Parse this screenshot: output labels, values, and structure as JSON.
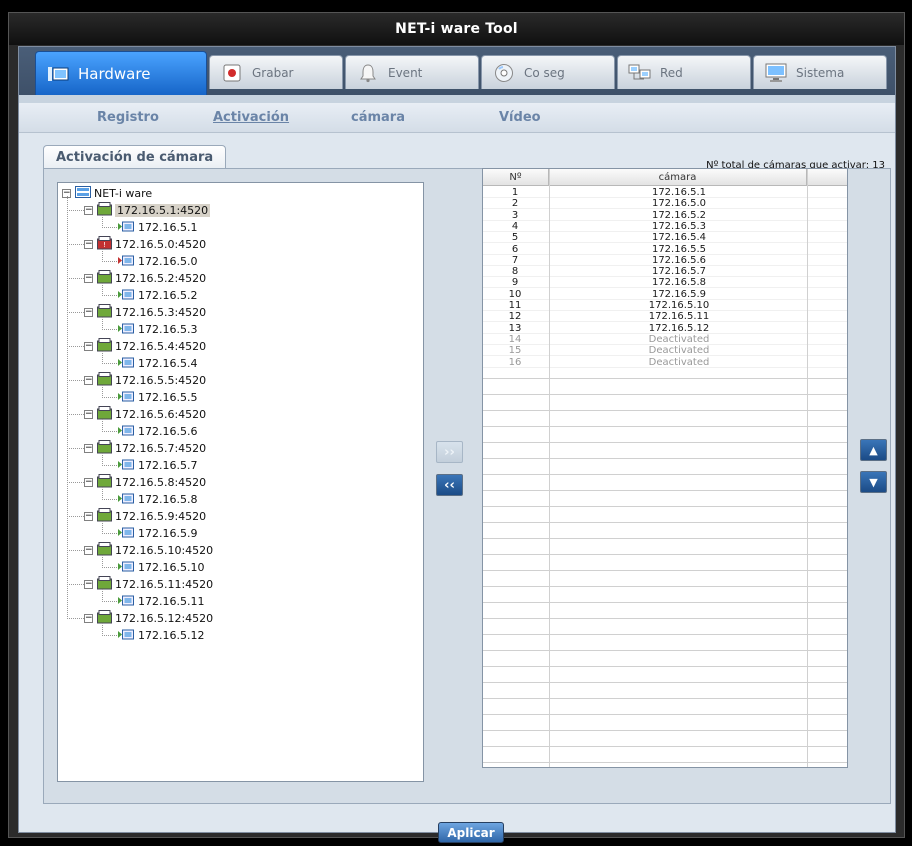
{
  "window": {
    "title": "NET-i ware Tool"
  },
  "tabs": [
    {
      "label": "Hardware",
      "icon": "hardware-icon"
    },
    {
      "label": "Grabar",
      "icon": "record-icon"
    },
    {
      "label": "Event",
      "icon": "bell-icon"
    },
    {
      "label": "Co seg",
      "icon": "disc-icon"
    },
    {
      "label": "Red",
      "icon": "network-icon"
    },
    {
      "label": "Sistema",
      "icon": "monitor-icon"
    }
  ],
  "subnav": [
    {
      "label": "Registro"
    },
    {
      "label": "Activación"
    },
    {
      "label": "cámara"
    },
    {
      "label": "Vídeo"
    }
  ],
  "panel": {
    "title": "Activación de cámara",
    "total_label": "Nº total de cámaras que activar: 13"
  },
  "tree": {
    "root": "NET-i ware",
    "encoders": [
      {
        "address": "172.16.5.1:4520",
        "camera": "172.16.5.1",
        "status": "ok"
      },
      {
        "address": "172.16.5.0:4520",
        "camera": "172.16.5.0",
        "status": "error"
      },
      {
        "address": "172.16.5.2:4520",
        "camera": "172.16.5.2",
        "status": "ok"
      },
      {
        "address": "172.16.5.3:4520",
        "camera": "172.16.5.3",
        "status": "ok"
      },
      {
        "address": "172.16.5.4:4520",
        "camera": "172.16.5.4",
        "status": "ok"
      },
      {
        "address": "172.16.5.5:4520",
        "camera": "172.16.5.5",
        "status": "ok"
      },
      {
        "address": "172.16.5.6:4520",
        "camera": "172.16.5.6",
        "status": "ok"
      },
      {
        "address": "172.16.5.7:4520",
        "camera": "172.16.5.7",
        "status": "ok"
      },
      {
        "address": "172.16.5.8:4520",
        "camera": "172.16.5.8",
        "status": "ok"
      },
      {
        "address": "172.16.5.9:4520",
        "camera": "172.16.5.9",
        "status": "ok"
      },
      {
        "address": "172.16.5.10:4520",
        "camera": "172.16.5.10",
        "status": "ok"
      },
      {
        "address": "172.16.5.11:4520",
        "camera": "172.16.5.11",
        "status": "ok"
      },
      {
        "address": "172.16.5.12:4520",
        "camera": "172.16.5.12",
        "status": "ok"
      }
    ]
  },
  "table": {
    "columns": [
      "Nº",
      "cámara"
    ],
    "rows": [
      {
        "n": "1",
        "camera": "172.16.5.1",
        "active": true
      },
      {
        "n": "2",
        "camera": "172.16.5.0",
        "active": true
      },
      {
        "n": "3",
        "camera": "172.16.5.2",
        "active": true
      },
      {
        "n": "4",
        "camera": "172.16.5.3",
        "active": true
      },
      {
        "n": "5",
        "camera": "172.16.5.4",
        "active": true
      },
      {
        "n": "6",
        "camera": "172.16.5.5",
        "active": true
      },
      {
        "n": "7",
        "camera": "172.16.5.6",
        "active": true
      },
      {
        "n": "8",
        "camera": "172.16.5.7",
        "active": true
      },
      {
        "n": "9",
        "camera": "172.16.5.8",
        "active": true
      },
      {
        "n": "10",
        "camera": "172.16.5.9",
        "active": true
      },
      {
        "n": "11",
        "camera": "172.16.5.10",
        "active": true
      },
      {
        "n": "12",
        "camera": "172.16.5.11",
        "active": true
      },
      {
        "n": "13",
        "camera": "172.16.5.12",
        "active": true
      },
      {
        "n": "14",
        "camera": "Deactivated",
        "active": false
      },
      {
        "n": "15",
        "camera": "Deactivated",
        "active": false
      },
      {
        "n": "16",
        "camera": "Deactivated",
        "active": false
      }
    ]
  },
  "buttons": {
    "apply": "Aplicar",
    "add_glyph": "››",
    "remove_glyph": "‹‹",
    "up_glyph": "▲",
    "down_glyph": "▼"
  },
  "colors": {
    "active_tab": "#1f74d6",
    "panel_bg": "#d4dde6",
    "ok_icon": "#6fa83a",
    "error_icon": "#c23030"
  }
}
